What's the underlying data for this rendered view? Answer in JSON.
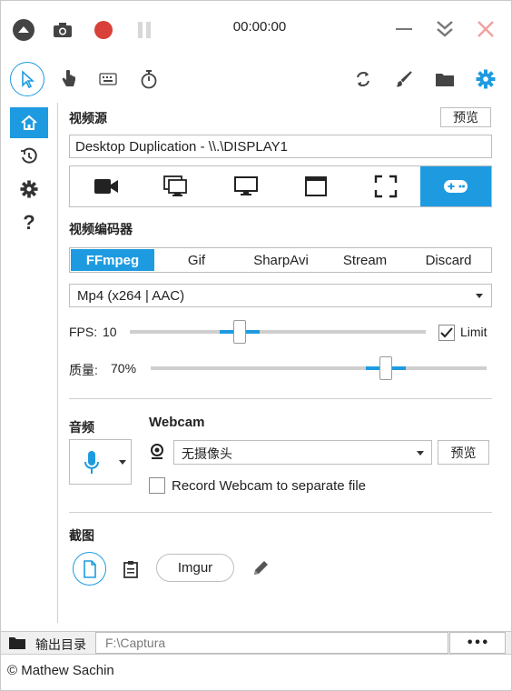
{
  "title_bar": {
    "timer": "00:00:00"
  },
  "video_source": {
    "title": "视频源",
    "preview_label": "预览",
    "selected": "Desktop Duplication - \\\\.\\DISPLAY1"
  },
  "video_encoder": {
    "title": "视频编码器",
    "tabs": [
      "FFmpeg",
      "Gif",
      "SharpAvi",
      "Stream",
      "Discard"
    ],
    "active_tab": "FFmpeg",
    "format": "Mp4 (x264 | AAC)",
    "fps_label": "FPS:",
    "fps_value": "10",
    "fps_fraction": 0.37,
    "limit_label": "Limit",
    "limit_checked": true,
    "quality_label": "质量:",
    "quality_value": "70%",
    "quality_fraction": 0.7
  },
  "audio": {
    "title": "音频"
  },
  "webcam": {
    "title": "Webcam",
    "selected": "无摄像头",
    "preview_label": "预览",
    "separate_file_label": "Record Webcam to separate file"
  },
  "screenshot": {
    "title": "截图",
    "imgur_label": "Imgur"
  },
  "output": {
    "label": "输出目录",
    "path": "F:\\Captura",
    "more_label": "•••"
  },
  "footer": {
    "copyright": "© Mathew Sachin"
  },
  "colors": {
    "accent": "#1e9be0",
    "record": "#d9403a",
    "close": "#f0a0a0"
  }
}
